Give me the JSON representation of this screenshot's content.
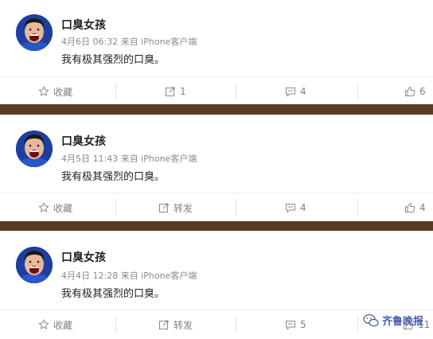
{
  "posts": [
    {
      "username": "口臭女孩",
      "meta": "4月6日 06:32 来自 iPhone客户端",
      "content": "我有极其强烈的口臭。",
      "actions": {
        "favorite": "收藏",
        "repost": "1",
        "comment": "4",
        "like": "6"
      }
    },
    {
      "username": "口臭女孩",
      "meta": "4月5日 11:43 来自 iPhone客户端",
      "content": "我有极其强烈的口臭。",
      "actions": {
        "favorite": "收藏",
        "repost": "转发",
        "comment": "4",
        "like": "4"
      }
    },
    {
      "username": "口臭女孩",
      "meta": "4月4日 12:28 来自 iPhone客户端",
      "content": "我有极其强烈的口臭。",
      "actions": {
        "favorite": "收藏",
        "repost": "转发",
        "comment": "5",
        "like": "11"
      }
    }
  ],
  "watermark": {
    "text": "齐鲁晚报",
    "icon": "wechat-icon"
  },
  "icons": [
    "star-icon",
    "repost-icon",
    "comment-icon",
    "thumbs-up-icon"
  ],
  "colors": {
    "separator": "#5a3a20",
    "avatar_bg": "#1e3f9f",
    "meta_text": "#8a8a8a"
  }
}
